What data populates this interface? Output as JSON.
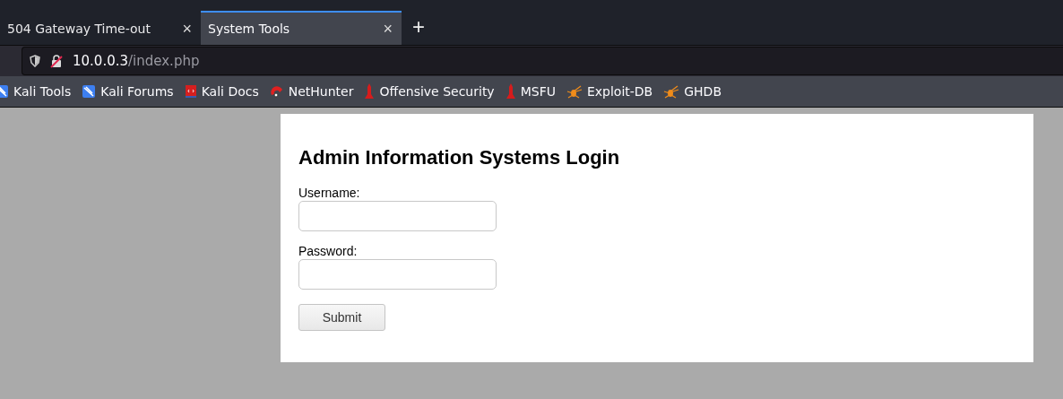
{
  "tabs": [
    {
      "label": "504 Gateway Time-out",
      "selected": false,
      "close": "×"
    },
    {
      "label": "System Tools",
      "selected": true,
      "close": "×"
    }
  ],
  "new_tab": "+",
  "address_bar": {
    "host": "10.0.0.3",
    "path": "/index.php"
  },
  "bookmarks": [
    {
      "label": "Kali Tools",
      "kind": "kali"
    },
    {
      "label": "Kali Forums",
      "kind": "kali"
    },
    {
      "label": "Kali Docs",
      "kind": "docs"
    },
    {
      "label": "NetHunter",
      "kind": "nethunter"
    },
    {
      "label": "Offensive Security",
      "kind": "offsec"
    },
    {
      "label": "MSFU",
      "kind": "offsec"
    },
    {
      "label": "Exploit-DB",
      "kind": "spider"
    },
    {
      "label": "GHDB",
      "kind": "spider"
    }
  ],
  "login": {
    "title": "Admin Information Systems Login",
    "fields": [
      {
        "label": "Username:"
      },
      {
        "label": "Password:"
      }
    ],
    "submit": "Submit"
  }
}
